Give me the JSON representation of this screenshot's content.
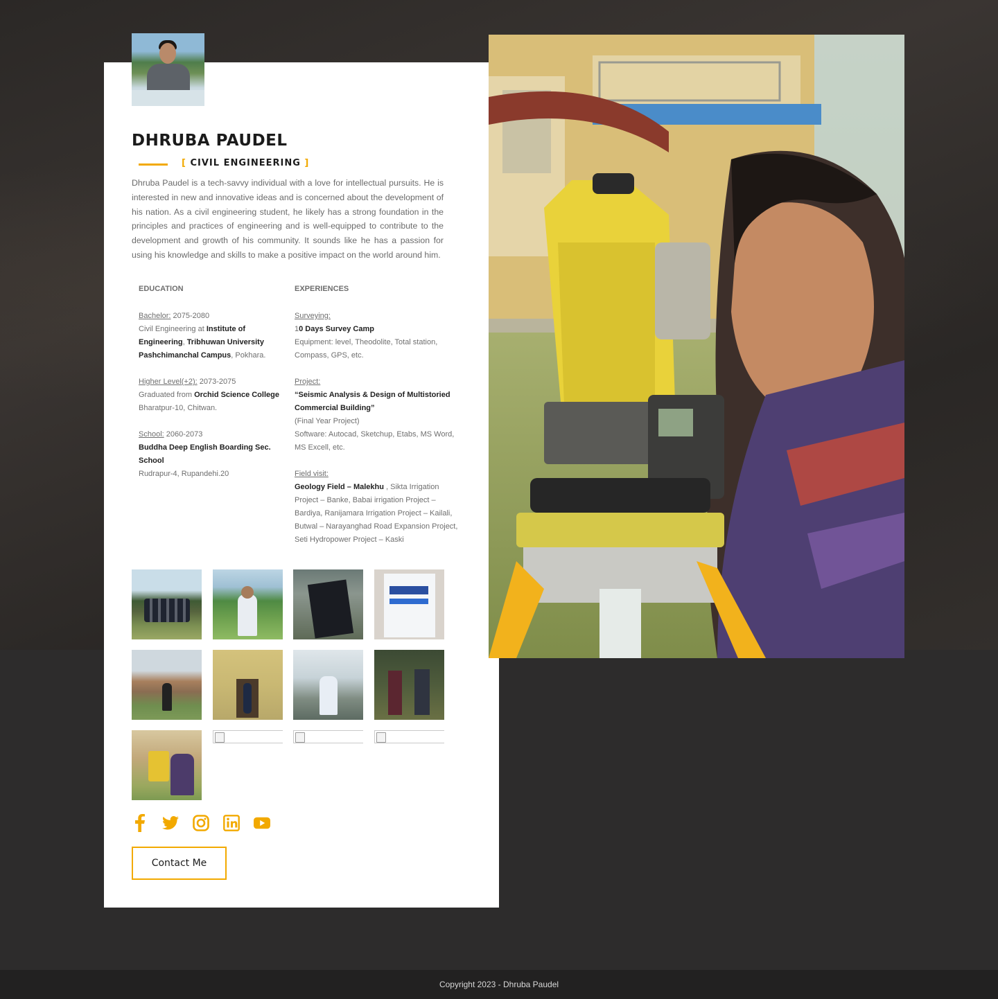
{
  "profile": {
    "name": "DHRUBA PAUDEL",
    "subtitle_open": "[",
    "subtitle": "CIVIL ENGINEERING",
    "subtitle_close": "]",
    "bio": "Dhruba Paudel is a tech-savvy individual with a love for intellectual pursuits. He is interested in new and innovative ideas and is concerned about the development of his nation. As a civil engineering student, he likely has a strong foundation in the principles and practices of engineering and is well-equipped to contribute to the development and growth of his community. It sounds like he has a passion for using his knowledge and skills to make a positive impact on the world around him."
  },
  "education": {
    "heading": "EDUCATION",
    "bachelor_label": "Bachelor:",
    "bachelor_years": " 2075-2080",
    "bachelor_pre": "Civil Engineering at ",
    "bachelor_inst1": "Institute of Engineering",
    "bachelor_sep": ", ",
    "bachelor_inst2": "Tribhuwan University Pashchimanchal Campus",
    "bachelor_post": ", Pokhara.",
    "higher_label": "Higher Level(+2):",
    "higher_years": " 2073-2075",
    "higher_pre": "Graduated from ",
    "higher_inst": "Orchid Science College",
    "higher_loc": "Bharatpur-10, Chitwan.",
    "school_label": "School:",
    "school_years": " 2060-2073",
    "school_inst": "Buddha Deep English Boarding Sec. School",
    "school_loc": "Rudrapur-4, Rupandehi.20"
  },
  "experiences": {
    "heading": "EXPERIENCES",
    "surveying_label": "Surveying:",
    "survey_prefix": "1",
    "survey_camp": "0 Days Survey Camp",
    "survey_equipment": "Equipment: level, Theodolite, Total station, Compass, GPS, etc.",
    "project_label": "Project:",
    "project_title": "“Seismic Analysis & Design of Multistoried Commercial Building”",
    "project_note": "(Final Year Project)",
    "project_software": "Software: Autocad, Sketchup, Etabs, MS Word, MS Excell,  etc.",
    "field_label": "Field visit:",
    "field_first": "Geology Field – Malekhu",
    "field_rest": " , Sikta Irrigation Project – Banke, Babai irrigation Project – Bardiya, Ranijamara Irrigation Project – Kailali, Butwal – Narayanghad Road Expansion Project, Seti Hydropower Project – Kaski"
  },
  "contact": {
    "button_label": "Contact Me"
  },
  "socials": [
    "facebook-icon",
    "twitter-icon",
    "instagram-icon",
    "linkedin-icon",
    "youtube-icon"
  ],
  "footer": {
    "copyright": "Copyright 2023 - Dhruba Paudel"
  },
  "colors": {
    "accent": "#f2a900",
    "background": "#2d2c2c",
    "card": "#ffffff"
  }
}
